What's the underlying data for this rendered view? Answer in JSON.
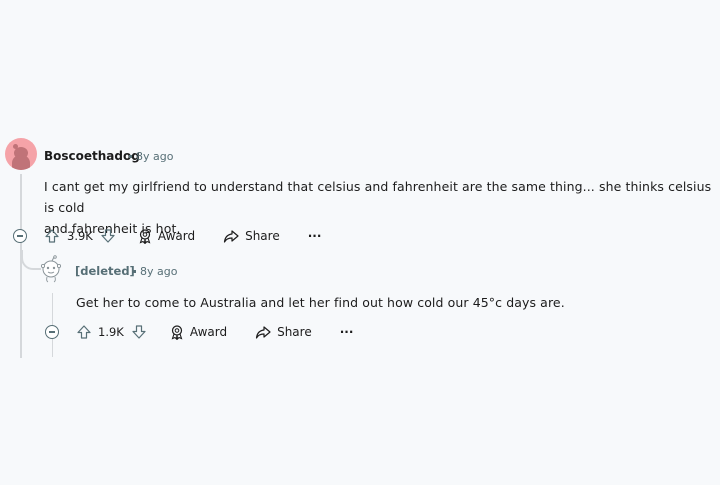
{
  "comment": {
    "author": "Boscoethadog",
    "time": "8y ago",
    "body_line1": "I cant get my girlfriend to understand that celsius and fahrenheit are the same thing... she thinks celsius is cold",
    "body_line2": "and fahrenheit is hot.",
    "votes": "3.9K",
    "award_label": "Award",
    "share_label": "Share",
    "more_label": "···"
  },
  "reply": {
    "author": "[deleted]",
    "time": "8y ago",
    "body": "Get her to come to Australia and let her find out how cold our 45°c days are.",
    "votes": "1.9K",
    "award_label": "Award",
    "share_label": "Share",
    "more_label": "···"
  },
  "colors": {
    "avatar_bg": "#f5a3a8",
    "thread_line": "#d5d8db",
    "meta_text": "#576f76"
  }
}
